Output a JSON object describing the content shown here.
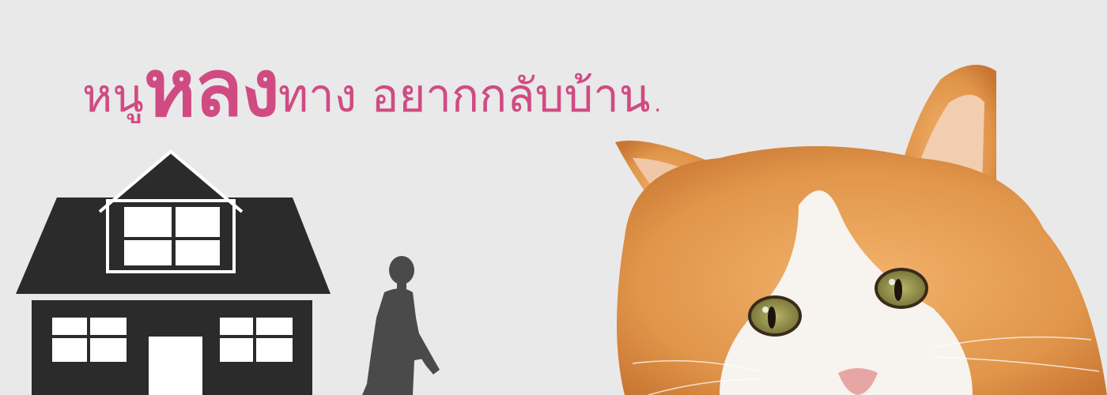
{
  "headline": {
    "prefix": "หนู",
    "emphasis": "หลง",
    "suffix": "ทาง อยากกลับบ้าน."
  },
  "colors": {
    "background": "#e9e9e9",
    "headline_pink": "#d04b82",
    "house_dark": "#2b2b2b",
    "person_gray": "#4a4a4a",
    "cat_orange": "#e0954a"
  },
  "icons": {
    "house": "house-icon",
    "person": "walking-person-icon",
    "cat": "cat-icon"
  }
}
